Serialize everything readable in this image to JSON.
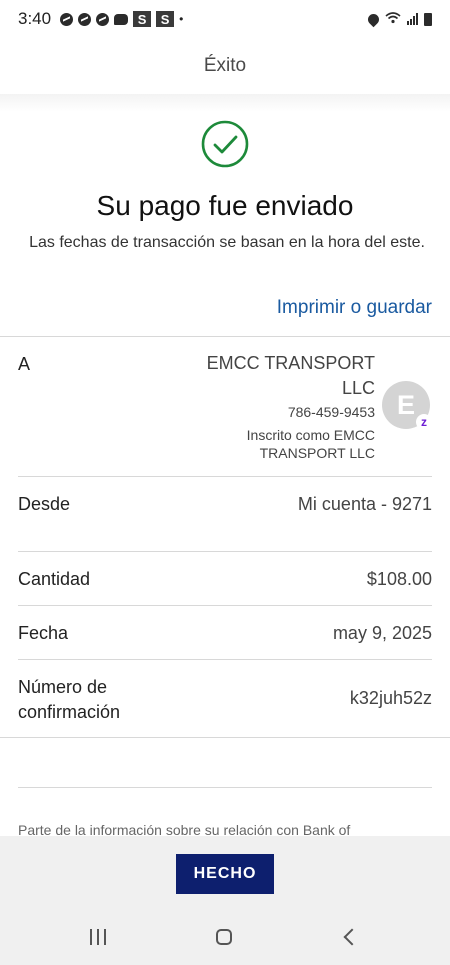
{
  "status_bar": {
    "time": "3:40",
    "badge_1": "S",
    "badge_2": "S",
    "dot": "•"
  },
  "header": {
    "title": "Éxito"
  },
  "success": {
    "title": "Su pago fue enviado",
    "subtitle": "Las fechas de transacción se basan en la hora del este.",
    "print_link": "Imprimir o guardar",
    "accent_color": "#1d8a3a"
  },
  "recipient": {
    "label": "A",
    "name": "EMCC TRANSPORT LLC",
    "phone": "786-459-9453",
    "enrolled_as": "Inscrito como EMCC TRANSPORT LLC",
    "avatar_initial": "E",
    "badge_letter": "z",
    "badge_icon": "zelle-icon"
  },
  "details": {
    "from_label": "Desde",
    "from_value": "Mi cuenta - 9271",
    "amount_label": "Cantidad",
    "amount_value": "$108.00",
    "date_label": "Fecha",
    "date_value": "may 9, 2025",
    "confirmation_label": "Número de confirmación",
    "confirmation_value": "k32juh52z"
  },
  "disclaimer": "Parte de la información sobre su relación con Bank of",
  "footer": {
    "done_label": "HECHO",
    "button_color": "#0d1f6e"
  },
  "nav": {
    "recents_icon": "recents-icon",
    "home_icon": "home-icon",
    "back_icon": "back-icon"
  }
}
